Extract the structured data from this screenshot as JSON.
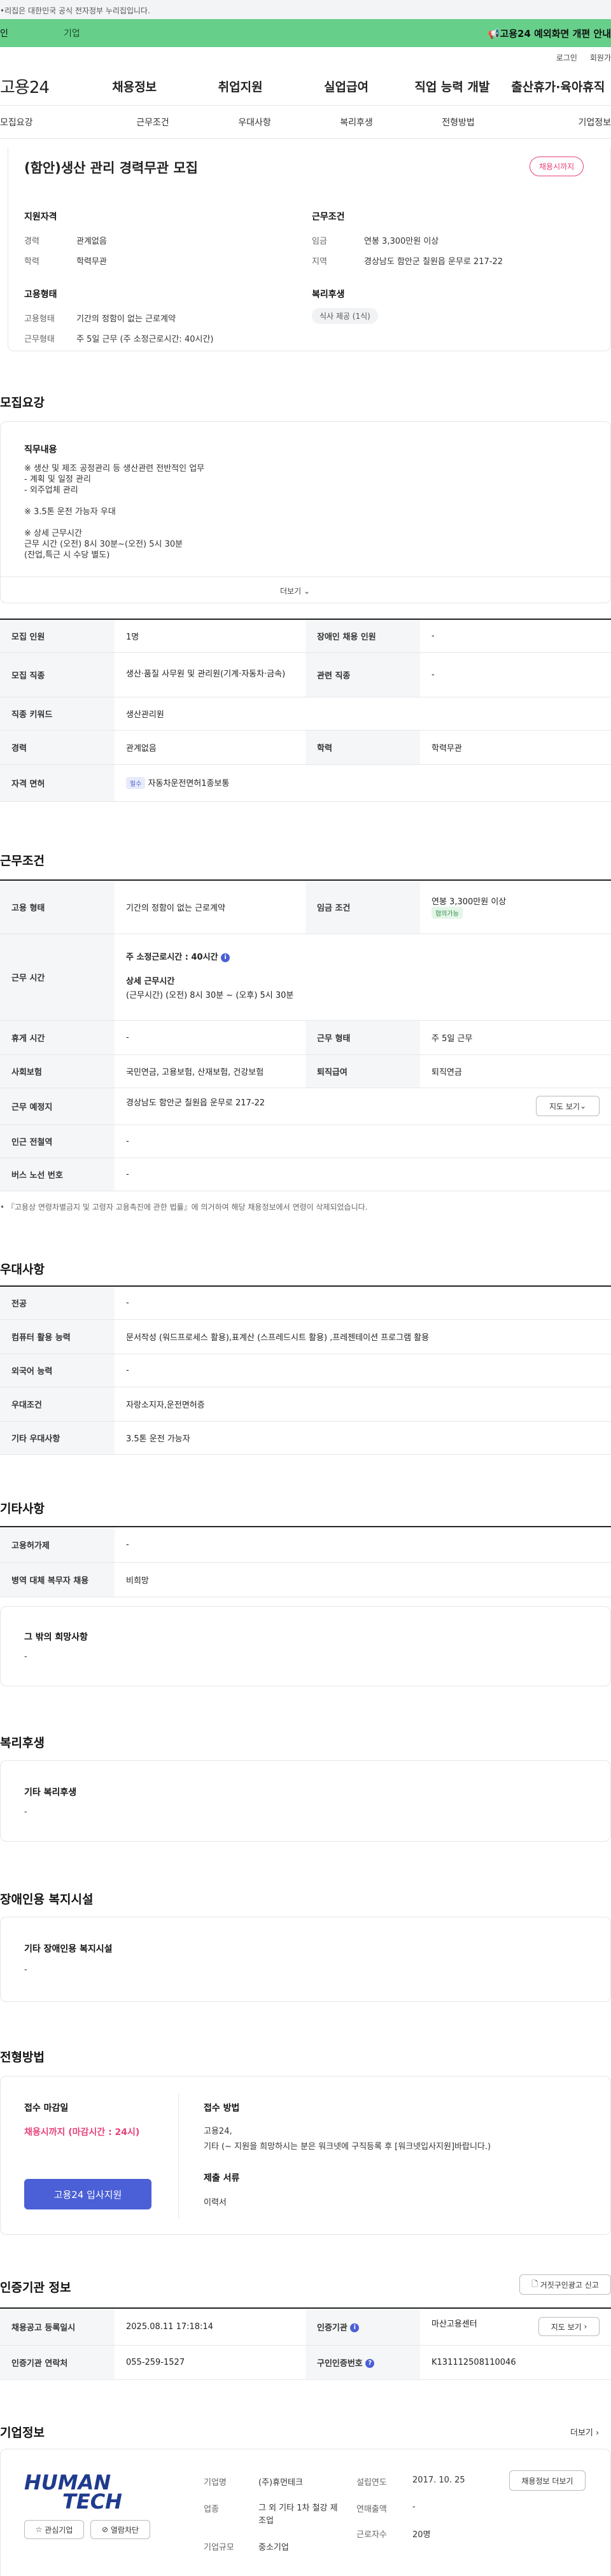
{
  "top": {
    "gov_notice": "•리집은 대한민국 공식 전자정부 누리집입니다.",
    "tab_left": "인",
    "tab_label": "기업",
    "notice": "고용24 예외화면 개편 안내"
  },
  "util": {
    "login": "로그인",
    "signup": "회원가"
  },
  "gnb": {
    "logo": "고용24",
    "items": [
      "채용정보",
      "취업지원",
      "실업급여",
      "직업 능력 개발",
      "출산휴가·육아휴직"
    ]
  },
  "tabs": [
    "모집요강",
    "근무조건",
    "우대사항",
    "복리후생",
    "전형방법",
    "기업정보"
  ],
  "summary": {
    "title": "(함안)생산 관리 경력무관 모집",
    "status_badge": "채용시까지",
    "qual_title": "지원자격",
    "career_label": "경력",
    "career": "관계없음",
    "edu_label": "학력",
    "edu": "학력무관",
    "cond_title": "근무조건",
    "wage_label": "임금",
    "wage": "연봉 3,300만원 이상",
    "region_label": "지역",
    "region": "경상남도 함안군 칠원읍 운무로 217-22",
    "emp_title": "고용형태",
    "emptype_label": "고용형태",
    "emptype": "기간의 정함이 없는 근로계약",
    "worktype_label": "근무형태",
    "worktype": "주 5일 근무 (주 소정근로시간: 40시간)",
    "welfare_title": "복리후생",
    "welfare_pill": "식사 제공 (1식)"
  },
  "recruit": {
    "section_title": "모집요강",
    "duty_title": "직무내용",
    "lines": [
      "※ 생산 및 제조 공정관리 등 생산관련 전반적인 업무",
      "- 계획 및 일정 관리",
      "- 외주업체 관리",
      "",
      "※ 3.5톤 운전 가능자 우대",
      "",
      "※ 상세 근무시간",
      "근무 시간 (오전) 8시 30분~(오전) 5시 30분",
      "(잔업,특근 시 수당 별도)"
    ],
    "more": "더보기",
    "rows": {
      "headcount_label": "모집 인원",
      "headcount": "1명",
      "disabled_label": "장애인 채용 인원",
      "disabled": "-",
      "job_label": "모집 직종",
      "job": "생산·품질 사무원 및 관리원(기계·자동차·금속)",
      "related_label": "관련 직종",
      "related": "-",
      "keyword_label": "직종 키워드",
      "keyword": "생산관리원",
      "career_label": "경력",
      "career": "관계없음",
      "edu_label": "학력",
      "edu": "학력무관",
      "license_label": "자격 면허",
      "license_chip": "필수",
      "license": "자동차운전면허1종보통"
    }
  },
  "work": {
    "section_title": "근무조건",
    "emp_label": "고용 형태",
    "emp": "기간의 정함이 없는 근로계약",
    "wage_label": "임금 조건",
    "wage": "연봉 3,300만원 이상",
    "wage_chip": "협의가능",
    "hours_label": "근무 시간",
    "hours_main": "주 소정근로시간 : 40시간",
    "hours_detail_title": "상세 근무시간",
    "hours_detail": "(근무시간) (오전) 8시 30분 ~ (오후) 5시 30분",
    "rest_label": "휴게 시간",
    "rest": "-",
    "shift_label": "근무 형태",
    "shift": "주 5일 근무",
    "insurance_label": "사회보험",
    "insurance": "국민연금, 고용보험, 산재보험, 건강보험",
    "severance_label": "퇴직급여",
    "severance": "퇴직연금",
    "place_label": "근무 예정지",
    "place": "경상남도 함안군 칠원읍 운무로 217-22",
    "map_btn": "지도 보기",
    "subway_label": "인근 전철역",
    "subway": "-",
    "bus_label": "버스 노선 번호",
    "bus": "-",
    "footnote": "• 『고용상 연령차별금지 및 고령자 고용촉진에 관한 법률』에 의거하여 해당 채용정보에서 연령이 삭제되었습니다."
  },
  "pref": {
    "section_title": "우대사항",
    "major_label": "전공",
    "major": "-",
    "computer_label": "컴퓨터 활용 능력",
    "computer": "문서작성 (워드프로세스 활용),표계산 (스프레드시트 활용) ,프레젠테이션 프로그램 활용",
    "lang_label": "외국어 능력",
    "lang": "-",
    "cond_label": "우대조건",
    "cond": "자랑소지자,운전면허증",
    "etc_label": "기타 우대사항",
    "etc": "3.5톤 운전 가능자"
  },
  "etc": {
    "section_title": "기타사항",
    "form_label": "고용허가제",
    "form": "-",
    "military_label": "병역 대체 복무자 채용",
    "military": "비희망",
    "other_title": "그 밖의 희망사항",
    "other": "-"
  },
  "benefit": {
    "section_title": "복리후생",
    "title": "기타 복리후생",
    "value": "-"
  },
  "disability": {
    "section_title": "장애인용 복지시설",
    "title": "기타 장애인용 복지시설",
    "value": "-"
  },
  "apply": {
    "section_title": "전형방법",
    "deadline_title": "접수 마감일",
    "deadline": "채용시까지 (마감시간 : 24시)",
    "apply_btn": "고용24 입사지원",
    "method_title": "접수 방법",
    "method_1": "고용24,",
    "method_2": "기타 (~ 지원을 희망하시는 분은 워크넷에 구직등록 후 [워크넷입사지원]바랍니다.)",
    "docs_title": "제출 서류",
    "docs": "이력서"
  },
  "agency": {
    "section_title": "인증기관 정보",
    "report_btn": "거짓구인광고 신고",
    "reg_label": "채용공고 등록일시",
    "reg": "2025.08.11 17:18:14",
    "agency_label": "인증기관",
    "agency": "마산고용센터",
    "map_btn": "지도 보기",
    "phone_label": "인증기관 연락처",
    "phone": "055-259-1527",
    "num_label": "구인인증번호",
    "num": "K131112508110046"
  },
  "company": {
    "section_title": "기업정보",
    "more": "더보기",
    "logo_line1": "HUMAN",
    "logo_line2": "TECH",
    "fav_btn": "관심기업",
    "block_btn": "열람차단",
    "name_label": "기업명",
    "name": "(주)휴먼테크",
    "industry_label": "업종",
    "industry": "그 외 기타 1차 철강 제조업",
    "size_label": "기업규모",
    "size": "중소기업",
    "founded_label": "설립연도",
    "founded": "2017. 10. 25",
    "sales_label": "연매출액",
    "sales": "-",
    "staff_label": "근로자수",
    "staff": "20명",
    "jobs_btn": "채용정보 더보기"
  }
}
